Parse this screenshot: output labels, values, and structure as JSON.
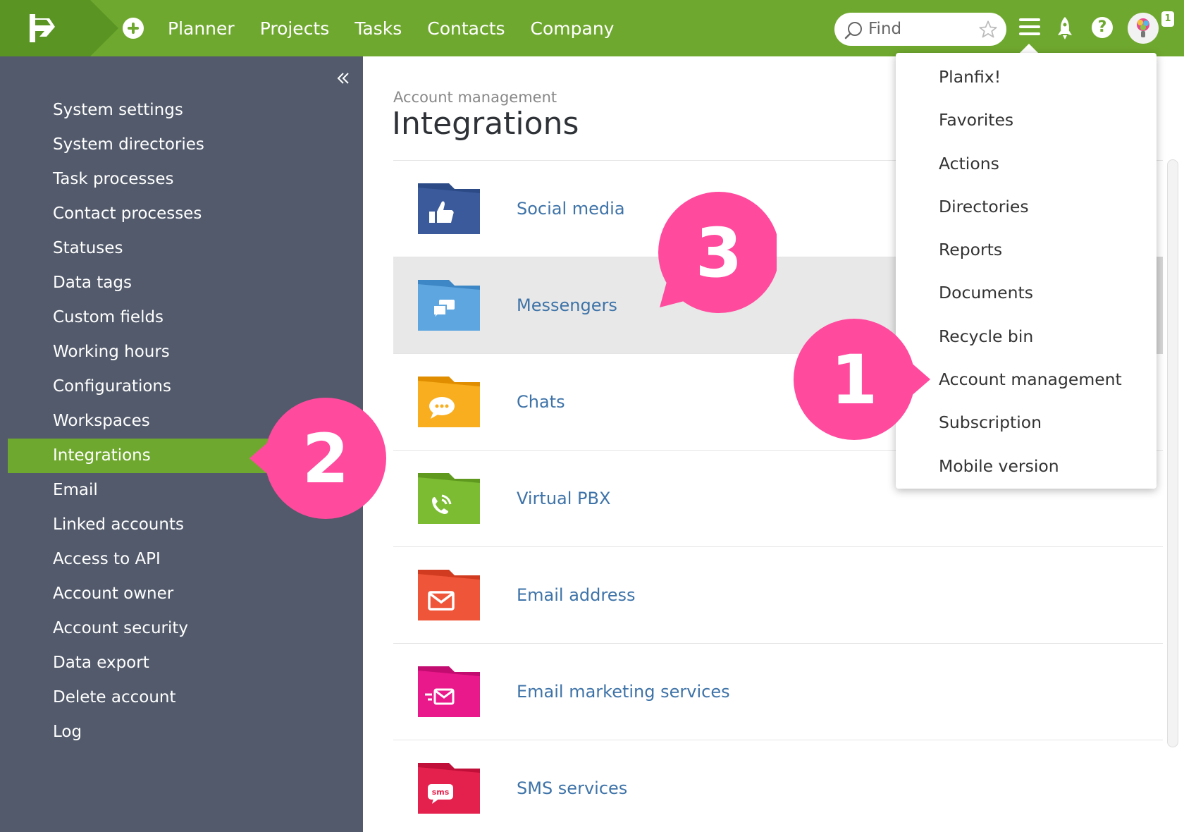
{
  "topbar": {
    "nav": [
      "Planner",
      "Projects",
      "Tasks",
      "Contacts",
      "Company"
    ],
    "search_placeholder": "Find",
    "notification_count": "1"
  },
  "sidebar": {
    "items": [
      "System settings",
      "System directories",
      "Task processes",
      "Contact processes",
      "Statuses",
      "Data tags",
      "Custom fields",
      "Working hours",
      "Configurations",
      "Workspaces",
      "Integrations",
      "Email",
      "Linked accounts",
      "Access to API",
      "Account owner",
      "Account security",
      "Data export",
      "Delete account",
      "Log"
    ],
    "active_index": 10
  },
  "main": {
    "breadcrumb": "Account management",
    "title": "Integrations",
    "items": [
      {
        "label": "Social media",
        "icon": "thumbs-up-icon",
        "color": "#3a5a9b",
        "tab": "#2b4a86"
      },
      {
        "label": "Messengers",
        "icon": "chat-bubbles-icon",
        "color": "#5ea6e0",
        "tab": "#3d87c6"
      },
      {
        "label": "Chats",
        "icon": "chat-dots-icon",
        "color": "#f8ae1e",
        "tab": "#e08e00"
      },
      {
        "label": "Virtual PBX",
        "icon": "phone-icon",
        "color": "#7cbc33",
        "tab": "#5f9a1f"
      },
      {
        "label": "Email address",
        "icon": "envelope-icon",
        "color": "#ef5538",
        "tab": "#d13b20"
      },
      {
        "label": "Email marketing services",
        "icon": "mail-send-icon",
        "color": "#e9188b",
        "tab": "#c20c70"
      },
      {
        "label": "SMS services",
        "icon": "sms-icon",
        "color": "#e4214d",
        "tab": "#c00f38"
      }
    ]
  },
  "dropdown": {
    "items": [
      "Planfix!",
      "Favorites",
      "Actions",
      "Directories",
      "Reports",
      "Documents",
      "Recycle bin",
      "Account management",
      "Subscription",
      "Mobile version"
    ]
  },
  "callouts": [
    "1",
    "2",
    "3"
  ],
  "colors": {
    "brand_green": "#6fa82f",
    "sidebar": "#525a6b",
    "callout_pink": "#ff4a9e",
    "link_blue": "#3e73a8"
  }
}
